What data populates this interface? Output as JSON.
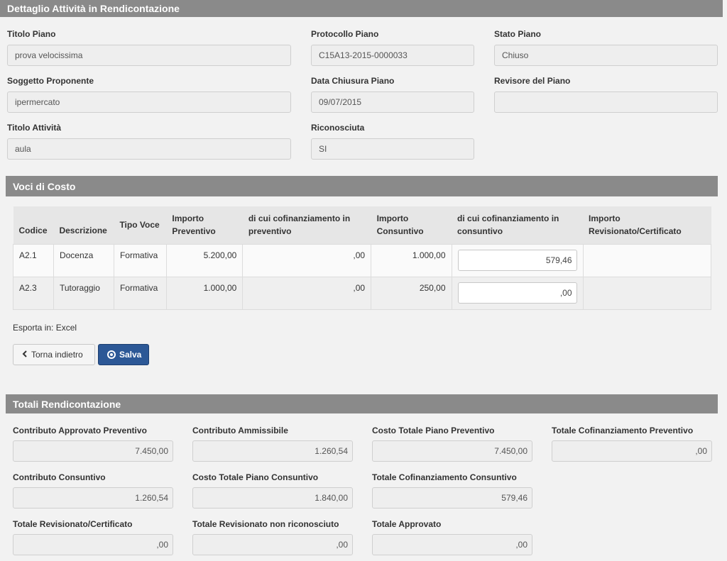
{
  "header": {
    "title": "Dettaglio Attività in Rendicontazione"
  },
  "dettaglio": {
    "titolo_piano": {
      "label": "Titolo Piano",
      "value": "prova velocissima"
    },
    "protocollo_piano": {
      "label": "Protocollo Piano",
      "value": "C15A13-2015-0000033"
    },
    "stato_piano": {
      "label": "Stato Piano",
      "value": "Chiuso"
    },
    "soggetto_proponente": {
      "label": "Soggetto Proponente",
      "value": "ipermercato"
    },
    "data_chiusura_piano": {
      "label": "Data Chiusura Piano",
      "value": "09/07/2015"
    },
    "revisore_del_piano": {
      "label": "Revisore del Piano",
      "value": ""
    },
    "titolo_attivita": {
      "label": "Titolo Attività",
      "value": "aula"
    },
    "riconosciuta": {
      "label": "Riconosciuta",
      "value": "SI"
    }
  },
  "voci": {
    "title": "Voci di Costo",
    "columns": [
      "Codice",
      "Descrizione",
      "Tipo Voce",
      "Importo Preventivo",
      "di cui cofinanziamento in preventivo",
      "Importo Consuntivo",
      "di cui cofinanziamento in consuntivo",
      "Importo Revisionato/Certificato"
    ],
    "rows": [
      {
        "codice": "A2.1",
        "descrizione": "Docenza",
        "tipo": "Formativa",
        "imp_prev": "5.200,00",
        "cofin_prev": ",00",
        "imp_cons": "1.000,00",
        "cofin_cons": "579,46",
        "revisionato": ""
      },
      {
        "codice": "A2.3",
        "descrizione": "Tutoraggio",
        "tipo": "Formativa",
        "imp_prev": "1.000,00",
        "cofin_prev": ",00",
        "imp_cons": "250,00",
        "cofin_cons": ",00",
        "revisionato": ""
      }
    ],
    "export_label": "Esporta in:",
    "export_link": "Excel"
  },
  "buttons": {
    "back": "Torna indietro",
    "save": "Salva"
  },
  "totali": {
    "title": "Totali Rendicontazione",
    "contributo_approvato_preventivo": {
      "label": "Contributo Approvato Preventivo",
      "value": "7.450,00"
    },
    "contributo_ammissibile": {
      "label": "Contributo Ammissibile",
      "value": "1.260,54"
    },
    "costo_totale_piano_preventivo": {
      "label": "Costo Totale Piano Preventivo",
      "value": "7.450,00"
    },
    "totale_cofinanziamento_preventivo": {
      "label": "Totale Cofinanziamento Preventivo",
      "value": ",00"
    },
    "contributo_consuntivo": {
      "label": "Contributo Consuntivo",
      "value": "1.260,54"
    },
    "costo_totale_piano_consuntivo": {
      "label": "Costo Totale Piano Consuntivo",
      "value": "1.840,00"
    },
    "totale_cofinanziamento_consuntivo": {
      "label": "Totale Cofinanziamento Consuntivo",
      "value": "579,46"
    },
    "totale_revisionato_certificato": {
      "label": "Totale Revisionato/Certificato",
      "value": ",00"
    },
    "totale_revisionato_non_riconosciuto": {
      "label": "Totale Revisionato non riconosciuto",
      "value": ",00"
    },
    "totale_approvato": {
      "label": "Totale Approvato",
      "value": ",00"
    }
  }
}
